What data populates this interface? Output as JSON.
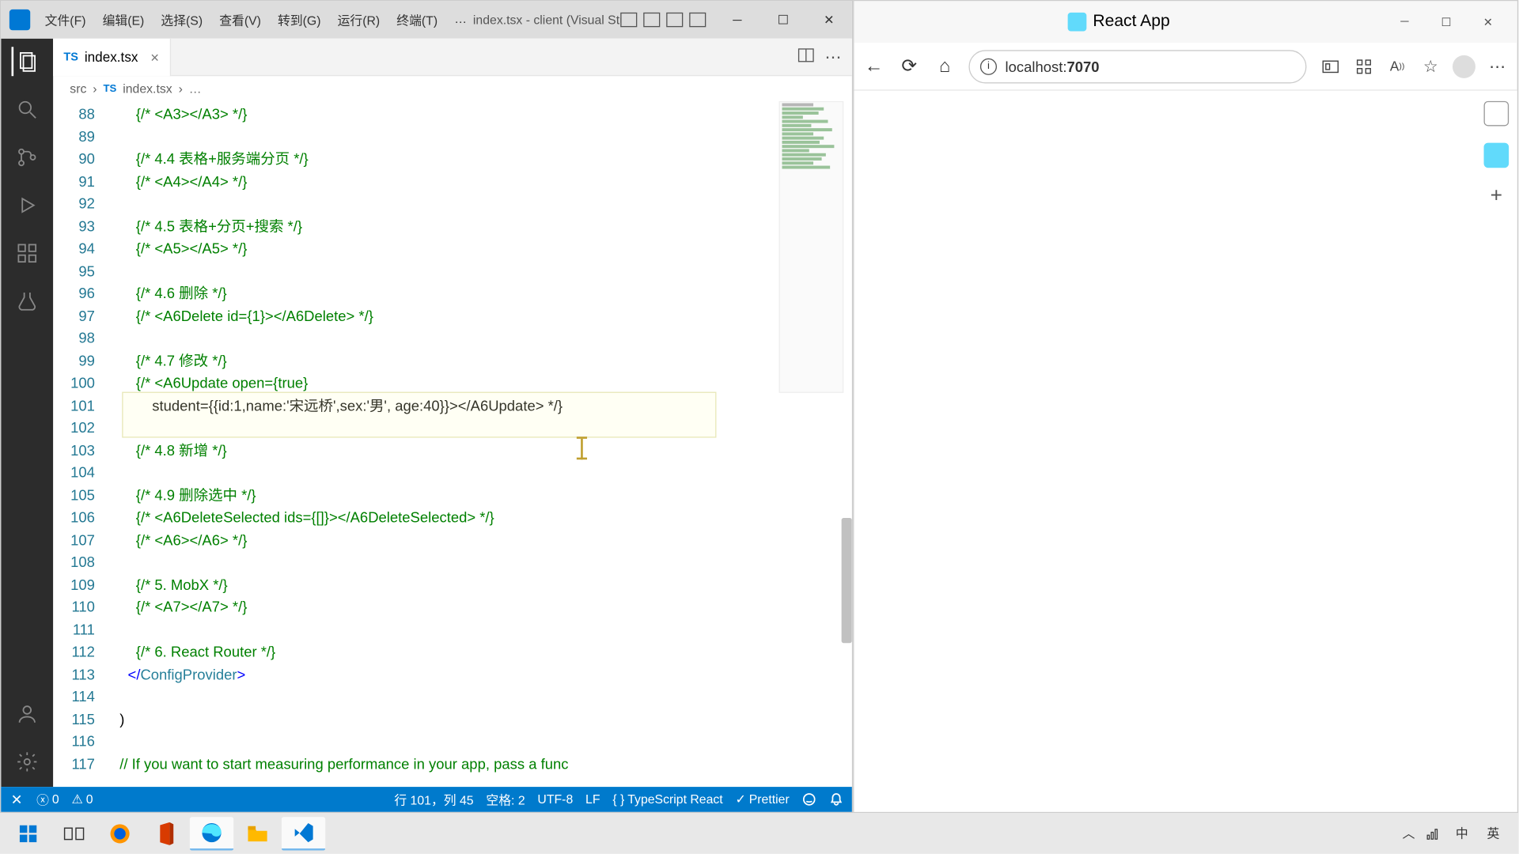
{
  "vscode": {
    "menu": [
      "文件(F)",
      "编辑(E)",
      "选择(S)",
      "查看(V)",
      "转到(G)",
      "运行(R)",
      "终端(T)",
      "…"
    ],
    "title_text": "index.tsx - client (Visual Studio Code)",
    "tab": {
      "icon": "TS",
      "name": "index.tsx"
    },
    "breadcrumb": {
      "folder": "src",
      "icon": "TS",
      "file": "index.tsx",
      "rest": "…"
    },
    "line_start": 88,
    "lines": [
      "{/* <A3></A3> */}",
      "",
      "{/* 4.4 表格+服务端分页 */}",
      "{/* <A4></A4> */}",
      "",
      "{/* 4.5 表格+分页+搜索 */}",
      "{/* <A5></A5> */}",
      "",
      "{/* 4.6 删除 */}",
      "{/* <A6Delete id={1}></A6Delete> */}",
      "",
      "{/* 4.7 修改 */}",
      "{/* <A6Update open={true}",
      "  student={{id:1,name:'宋远桥',sex:'男', age:40}}></A6Update> */}",
      "",
      "{/* 4.8 新增 */}",
      "",
      "{/* 4.9 删除选中 */}",
      "{/* <A6DeleteSelected ids={[]}></A6DeleteSelected> */}",
      "{/* <A6></A6> */}",
      "",
      "{/* 5. MobX */}",
      "{/* <A7></A7> */}",
      "",
      "{/* 6. React Router */}",
      "</ConfigProvider>",
      "",
      ")",
      "",
      "// If you want to start measuring performance in your app, pass a func"
    ],
    "indents": [
      3,
      0,
      3,
      3,
      0,
      3,
      3,
      0,
      3,
      3,
      0,
      3,
      3,
      4,
      0,
      3,
      0,
      3,
      3,
      3,
      0,
      3,
      3,
      0,
      3,
      2,
      0,
      1,
      0,
      1
    ],
    "statusbar": {
      "errors": "0",
      "warnings": "0",
      "ln_col": "行 101，列 45",
      "spaces": "空格: 2",
      "encoding": "UTF-8",
      "eol": "LF",
      "lang": "TypeScript React",
      "prettier": "Prettier"
    }
  },
  "browser": {
    "title": "React App",
    "url_host": "localhost:",
    "url_port": "7070"
  },
  "taskbar": {
    "ime1": "中",
    "ime2": "英"
  }
}
